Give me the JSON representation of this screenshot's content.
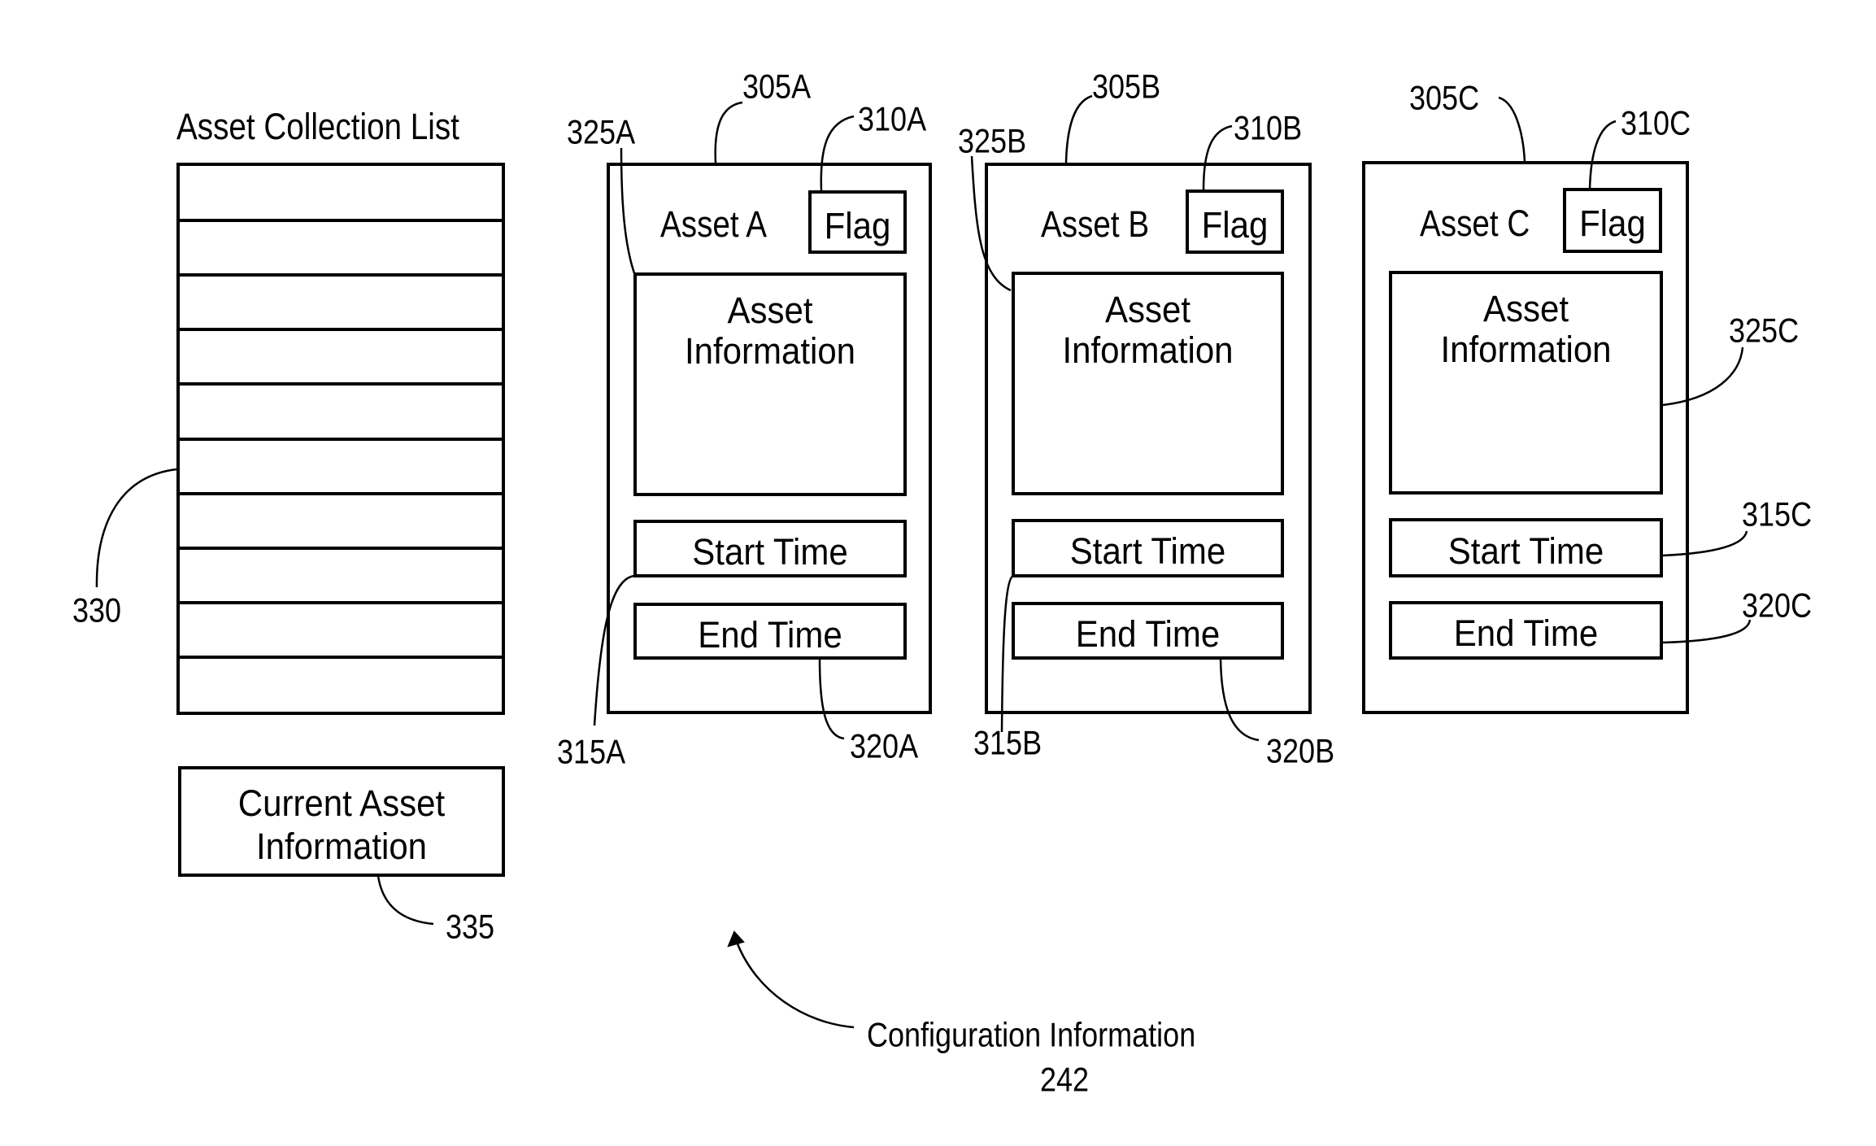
{
  "figure": {
    "collection_list": {
      "title": "Asset Collection List",
      "row_count": 10,
      "ref": "330"
    },
    "current_asset": {
      "line1": "Current Asset",
      "line2": "Information",
      "ref": "335"
    },
    "assets": [
      {
        "name": "Asset A",
        "flag": "Flag",
        "info_line1": "Asset",
        "info_line2": "Information",
        "start_time": "Start Time",
        "end_time": "End Time",
        "ref_card": "305A",
        "ref_flag": "310A",
        "ref_start": "315A",
        "ref_end": "320A",
        "ref_info": "325A"
      },
      {
        "name": "Asset B",
        "flag": "Flag",
        "info_line1": "Asset",
        "info_line2": "Information",
        "start_time": "Start Time",
        "end_time": "End Time",
        "ref_card": "305B",
        "ref_flag": "310B",
        "ref_start": "315B",
        "ref_end": "320B",
        "ref_info": "325B"
      },
      {
        "name": "Asset C",
        "flag": "Flag",
        "info_line1": "Asset",
        "info_line2": "Information",
        "start_time": "Start Time",
        "end_time": "End Time",
        "ref_card": "305C",
        "ref_flag": "310C",
        "ref_start": "315C",
        "ref_end": "320C",
        "ref_info": "325C"
      }
    ],
    "caption": {
      "label": "Configuration Information",
      "ref": "242"
    }
  }
}
